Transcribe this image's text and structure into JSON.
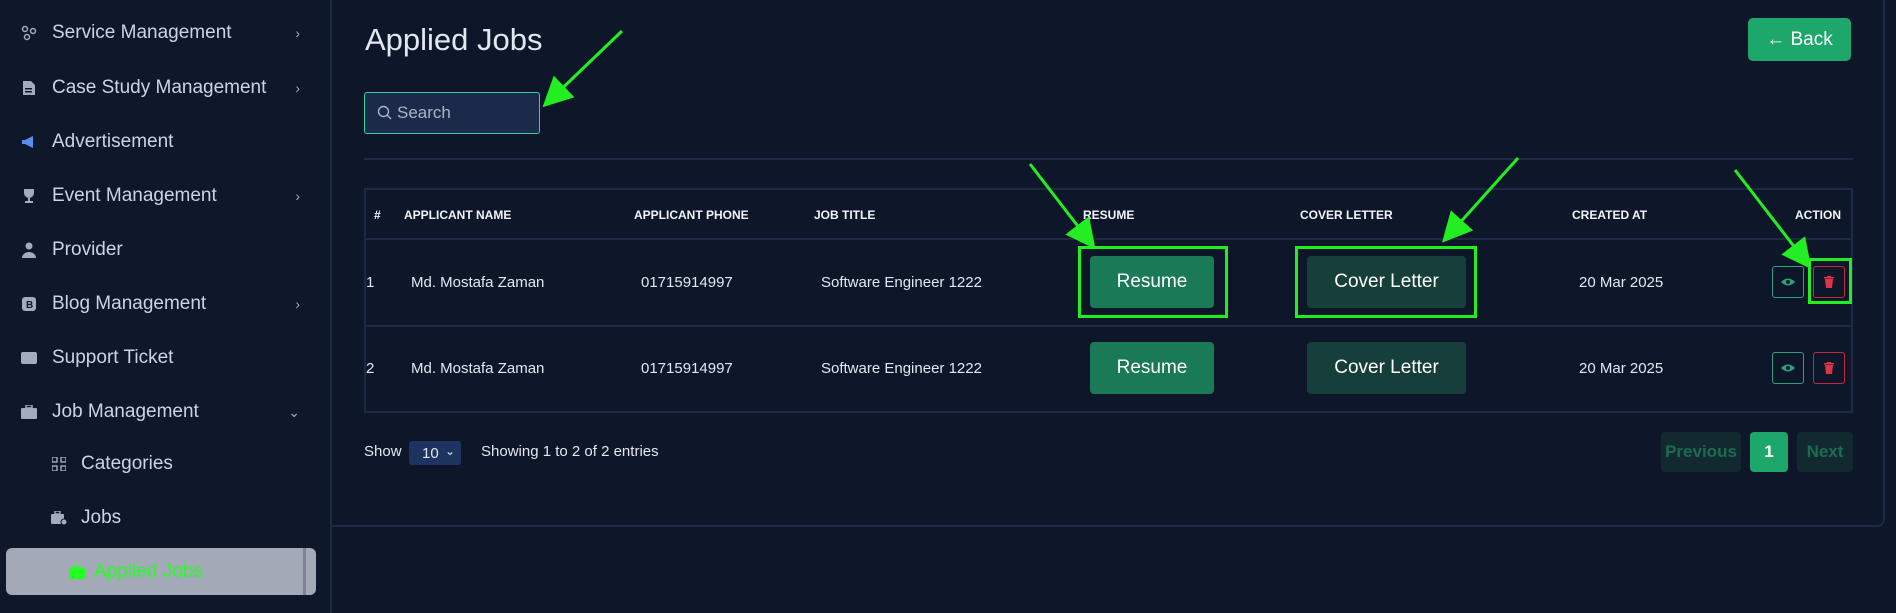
{
  "sidebar": {
    "items": [
      {
        "label": "Service Management",
        "icon": "nodes-icon",
        "has_chevron": true
      },
      {
        "label": "Case Study Management",
        "icon": "document-icon",
        "has_chevron": true
      },
      {
        "label": "Advertisement",
        "icon": "megaphone-icon",
        "has_chevron": false
      },
      {
        "label": "Event Management",
        "icon": "trophy-icon",
        "has_chevron": true
      },
      {
        "label": "Provider",
        "icon": "user-tie-icon",
        "has_chevron": false
      },
      {
        "label": "Blog Management",
        "icon": "blog-icon",
        "has_chevron": true
      },
      {
        "label": "Support Ticket",
        "icon": "ticket-icon",
        "has_chevron": false
      },
      {
        "label": "Job Management",
        "icon": "briefcase-icon",
        "has_chevron": true,
        "expanded": true
      }
    ],
    "sub_items": [
      {
        "label": "Categories",
        "icon": "grid-icon"
      },
      {
        "label": "Jobs",
        "icon": "briefcase-gear-icon"
      },
      {
        "label": "Applied Jobs",
        "icon": "briefcase-icon",
        "active": true
      }
    ]
  },
  "page": {
    "title": "Applied Jobs",
    "back_label": "← Back"
  },
  "search": {
    "placeholder": "Search",
    "value": ""
  },
  "table": {
    "headers": [
      "#",
      "APPLICANT NAME",
      "APPLICANT PHONE",
      "JOB TITLE",
      "RESUME",
      "COVER LETTER",
      "CREATED AT",
      "ACTION"
    ],
    "rows": [
      {
        "index": "1",
        "name": "Md. Mostafa Zaman",
        "phone": "01715914997",
        "job_title": "Software Engineer 1222",
        "resume_label": "Resume",
        "cover_label": "Cover Letter",
        "created_at": "20 Mar 2025"
      },
      {
        "index": "2",
        "name": "Md. Mostafa Zaman",
        "phone": "01715914997",
        "job_title": "Software Engineer 1222",
        "resume_label": "Resume",
        "cover_label": "Cover Letter",
        "created_at": "20 Mar 2025"
      }
    ]
  },
  "footer": {
    "show_label": "Show",
    "page_size": "10",
    "entries_text": "Showing 1 to 2 of 2 entries",
    "prev_label": "Previous",
    "current_page": "1",
    "next_label": "Next"
  },
  "colors": {
    "background": "#0e172a",
    "accent_green": "#1ea76b",
    "highlight": "#22ee22",
    "danger": "#c02a3a"
  }
}
